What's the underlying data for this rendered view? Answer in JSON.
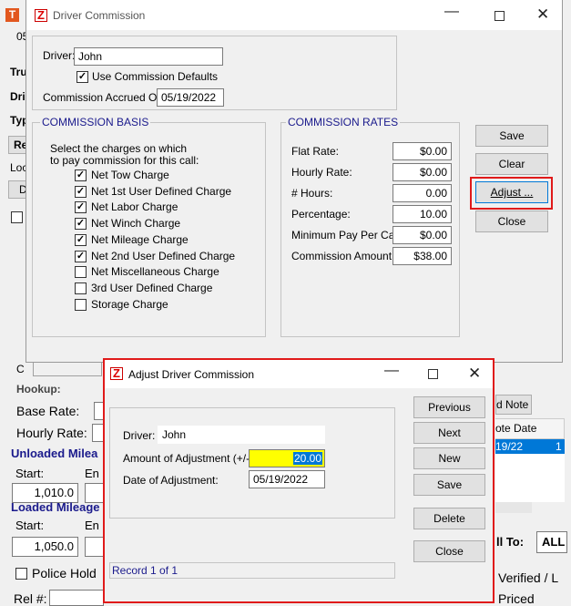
{
  "bg": {
    "app_icon_letter": "T",
    "fragments": {
      "top_05": "05",
      "tru": "Tru",
      "dri": "Dri",
      "typ": "Typ",
      "re": "Re",
      "loc": "Loc",
      "d": "D",
      "c": "C",
      "hookup": "Hookup:",
      "base_rate": "Base Rate:",
      "hourly_rate": "Hourly Rate:",
      "unloaded_mileage": "Unloaded Milea",
      "start1": "Start:",
      "en1": "En",
      "start1_value": "1,010.0",
      "loaded_mileage": "Loaded Mileage",
      "start2": "Start:",
      "en2": "En",
      "start2_value": "1,050.0",
      "police_hold": "Police Hold",
      "rel": "Rel #:",
      "d_note": "d Note",
      "note_date": "ote Date",
      "date_cell": "19/22",
      "date_cell_tail": "1",
      "ll_to": "ll To:",
      "all": "ALL",
      "verified": "Verified / L",
      "priced": "Priced"
    }
  },
  "driver_commission": {
    "title": "Driver Commission",
    "driver_label": "Driver:",
    "driver_value": "John",
    "use_defaults_label": "Use Commission Defaults",
    "use_defaults_checked": true,
    "accrued_label": "Commission Accrued On:",
    "accrued_value": "05/19/2022",
    "basis": {
      "title": "COMMISSION BASIS",
      "instructions_1": "Select the charges on which",
      "instructions_2": "to pay commission for this call:",
      "items": [
        {
          "label": "Net Tow Charge",
          "checked": true
        },
        {
          "label": "Net 1st User Defined Charge",
          "checked": true
        },
        {
          "label": "Net Labor Charge",
          "checked": true
        },
        {
          "label": "Net Winch Charge",
          "checked": true
        },
        {
          "label": "Net Mileage Charge",
          "checked": true
        },
        {
          "label": "Net 2nd User Defined Charge",
          "checked": true
        },
        {
          "label": "Net Miscellaneous Charge",
          "checked": false
        },
        {
          "label": "3rd User Defined Charge",
          "checked": false
        },
        {
          "label": "Storage Charge",
          "checked": false
        }
      ]
    },
    "rates": {
      "title": "COMMISSION RATES",
      "rows": [
        {
          "label": "Flat Rate:",
          "value": "$0.00"
        },
        {
          "label": "Hourly Rate:",
          "value": "$0.00"
        },
        {
          "label": "# Hours:",
          "value": "0.00"
        },
        {
          "label": "Percentage:",
          "value": "10.00"
        },
        {
          "label": "Minimum Pay Per Call:",
          "value": "$0.00"
        },
        {
          "label": "Commission Amount:",
          "value": "$38.00"
        }
      ]
    },
    "buttons": {
      "save": "Save",
      "clear": "Clear",
      "adjust": "Adjust ...",
      "close": "Close"
    }
  },
  "adjust_dialog": {
    "title": "Adjust Driver Commission",
    "driver_label": "Driver:",
    "driver_value": "John",
    "amount_label": "Amount of Adjustment (+/-):",
    "amount_value": "20.00",
    "date_label": "Date of Adjustment:",
    "date_value": "05/19/2022",
    "status": "Record 1 of 1",
    "buttons": {
      "previous": "Previous",
      "next": "Next",
      "new": "New",
      "save": "Save",
      "delete": "Delete",
      "close": "Close"
    }
  },
  "colors": {
    "highlight_red": "#e01a1a",
    "amount_bg": "#ffff00",
    "selection_blue": "#0078d7",
    "group_title": "#1a1a8c"
  }
}
